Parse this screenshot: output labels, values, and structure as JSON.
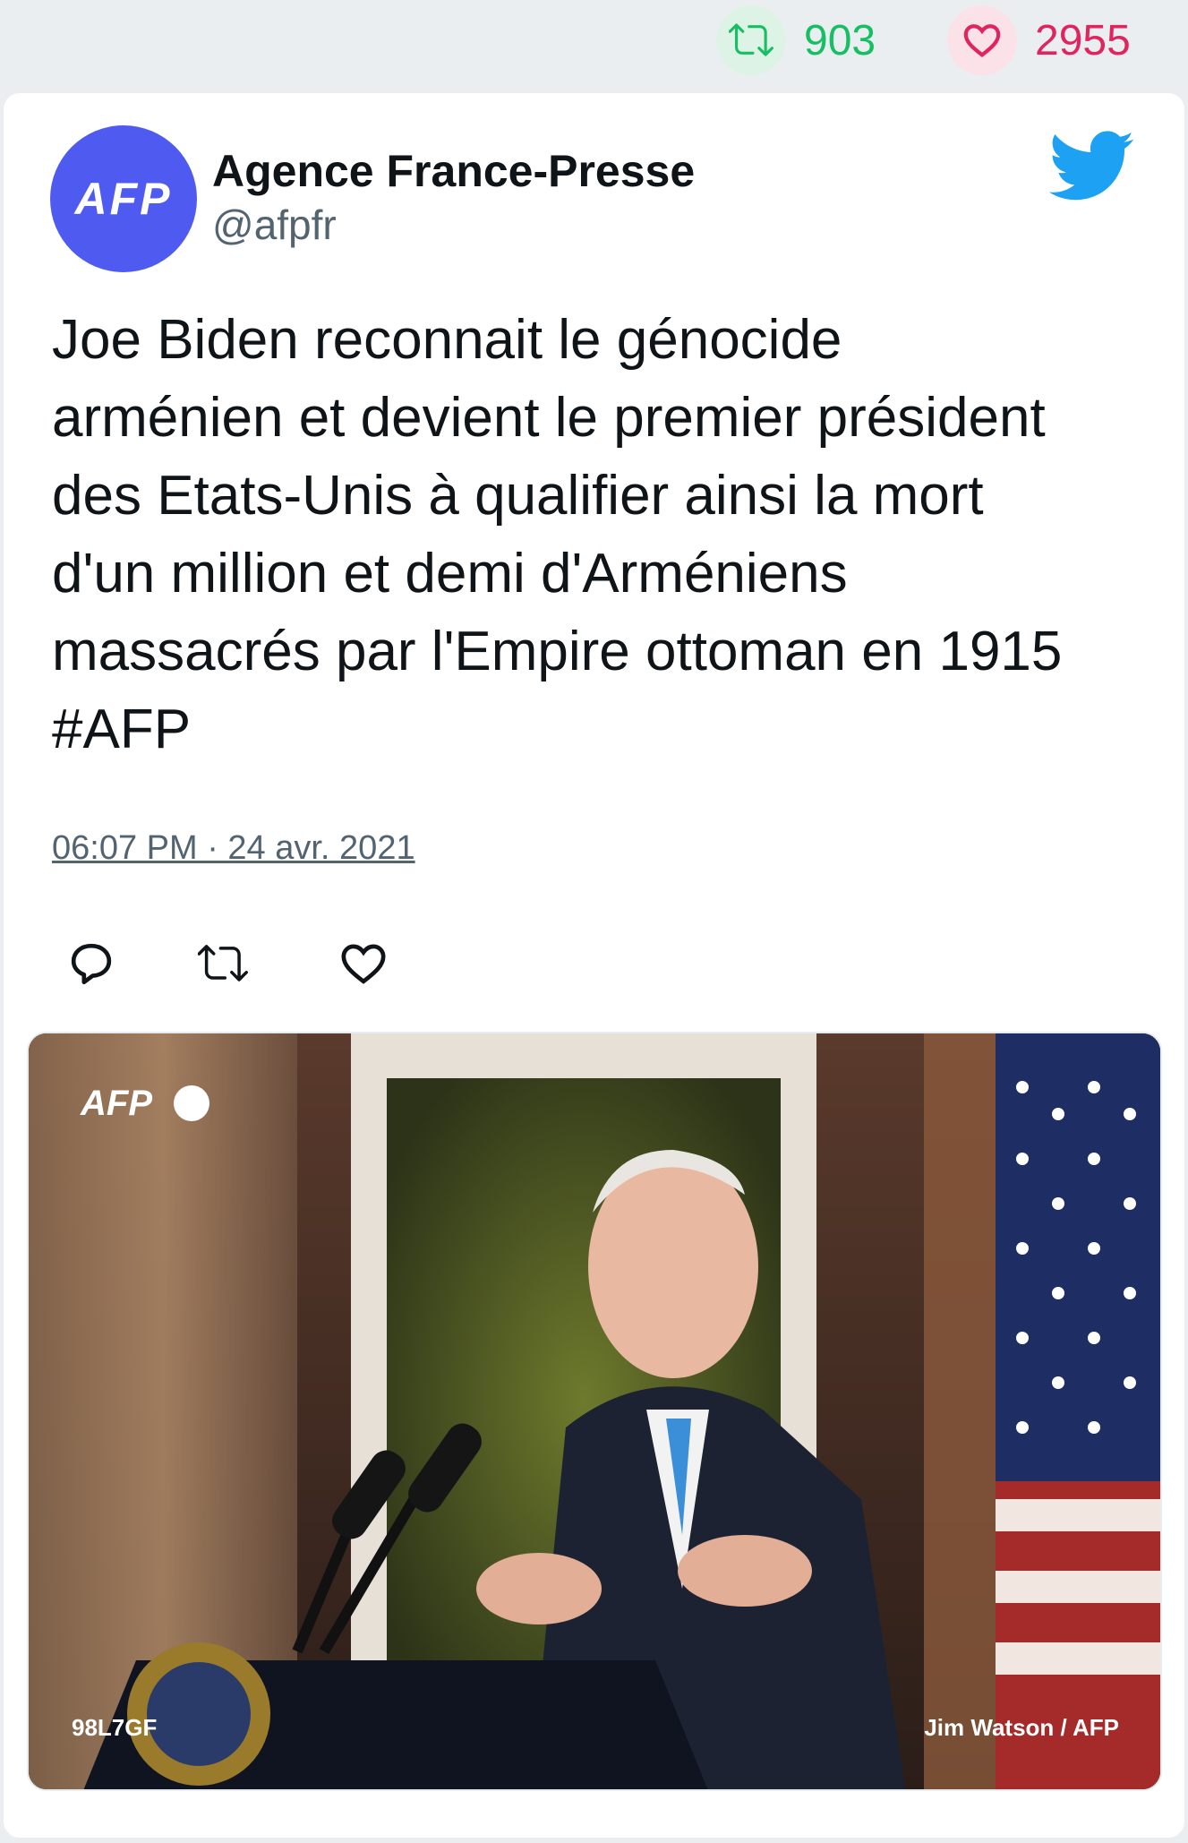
{
  "stats": {
    "retweets": "903",
    "likes": "2955",
    "retweet_color": "#17bf63",
    "like_color": "#e0245e"
  },
  "tweet": {
    "author_name": "Agence France-Presse",
    "author_handle": "@afpfr",
    "avatar_text": "AFP",
    "avatar_color": "#4f5bf0",
    "text": "Joe Biden reconnait le génocide\narménien et devient le premier président\ndes Etats-Unis à qualifier ainsi la mort\nd'un million et demi d'Arméniens\nmassacrés par l'Empire ottoman en 1915\n#AFP",
    "timestamp": "06:07 PM · 24 avr. 2021",
    "platform_icon": "twitter-bird-icon",
    "brand_color": "#1da1f2"
  },
  "actions": [
    {
      "name": "reply",
      "icon": "reply-icon"
    },
    {
      "name": "retweet",
      "icon": "retweet-icon"
    },
    {
      "name": "like",
      "icon": "heart-icon"
    }
  ],
  "media": {
    "watermark": "AFP",
    "photo_code": "98L7GF",
    "credit": "Jim Watson / AFP"
  }
}
